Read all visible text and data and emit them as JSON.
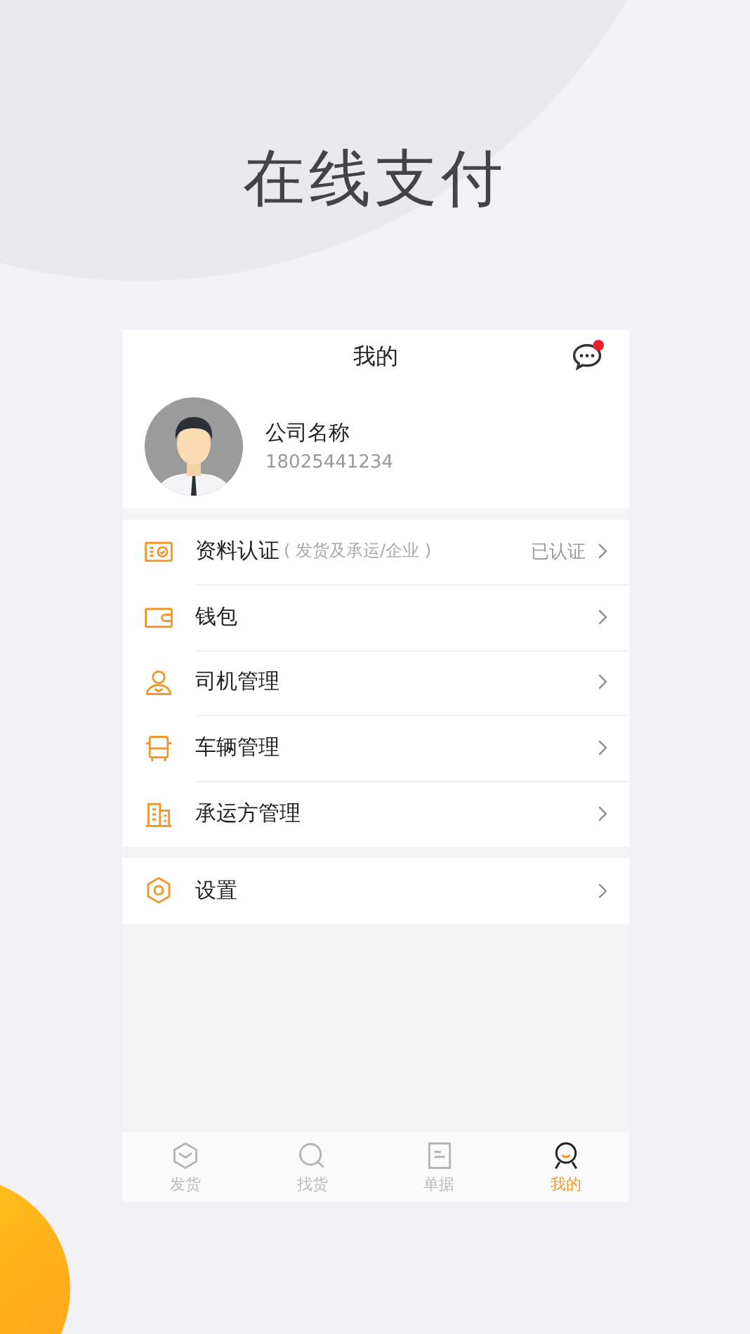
{
  "headline": "在线支付",
  "header": {
    "title": "我的",
    "message_unread": true
  },
  "profile": {
    "company": "公司名称",
    "phone": "18025441234"
  },
  "menu_groups": [
    {
      "items": [
        {
          "kind": "certification",
          "label": "资料认证",
          "hint": "( 发货及承运/企业 )",
          "status": "已认证"
        },
        {
          "kind": "wallet",
          "label": "钱包"
        },
        {
          "kind": "driver",
          "label": "司机管理"
        },
        {
          "kind": "vehicle",
          "label": "车辆管理"
        },
        {
          "kind": "carrier",
          "label": "承运方管理"
        }
      ]
    },
    {
      "items": [
        {
          "kind": "settings",
          "label": "设置"
        }
      ]
    }
  ],
  "tabs": [
    {
      "kind": "ship",
      "label": "发货",
      "selected": false
    },
    {
      "kind": "find",
      "label": "找货",
      "selected": false
    },
    {
      "kind": "document",
      "label": "单据",
      "selected": false
    },
    {
      "kind": "me",
      "label": "我的",
      "selected": true
    }
  ]
}
